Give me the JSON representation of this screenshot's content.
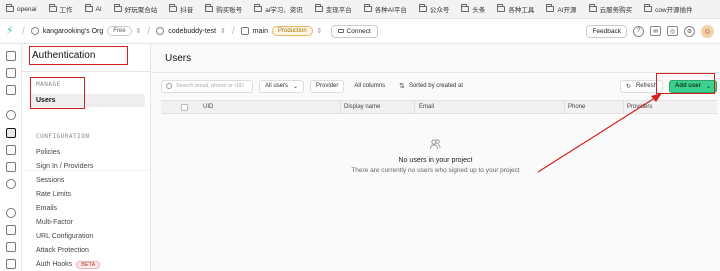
{
  "bookmarks": [
    "openai",
    "工作",
    "AI",
    "好玩聚合站",
    "抖音",
    "购买账号",
    "ai学习、资讯",
    "变现平台",
    "各种AI平台",
    "公众号",
    "头条",
    "各种工具",
    "AI开源",
    "云服务购买",
    "cow开源插件"
  ],
  "topnav": {
    "org": "kangarooking's Org",
    "org_plan": "Free",
    "project": "codebuddy-test",
    "branch": "main",
    "env": "Production",
    "connect": "Connect",
    "feedback": "Feedback"
  },
  "sidebar": {
    "title": "Authentication",
    "manage_label": "MANAGE",
    "manage_items": [
      "Users"
    ],
    "config_label": "CONFIGURATION",
    "config_items": [
      "Policies",
      "Sign In / Providers",
      "Sessions",
      "Rate Limits",
      "Emails",
      "Multi-Factor",
      "URL Configuration",
      "Attack Protection",
      "Auth Hooks"
    ],
    "beta": "BETA"
  },
  "main": {
    "title": "Users",
    "search_placeholder": "Search email, phone or UID",
    "filter_users": "All users",
    "provider": "Provider",
    "columns": "All columns",
    "sort": "Sorted by created at",
    "refresh": "Refresh",
    "add_user": "Add user",
    "headers": [
      "UID",
      "Display name",
      "Email",
      "Phone",
      "Providers"
    ],
    "empty_title": "No users in your project",
    "empty_sub": "There are currently no users who signed up to your project"
  },
  "colors": {
    "accent": "#3ecf8e",
    "annotation": "#d32020"
  }
}
